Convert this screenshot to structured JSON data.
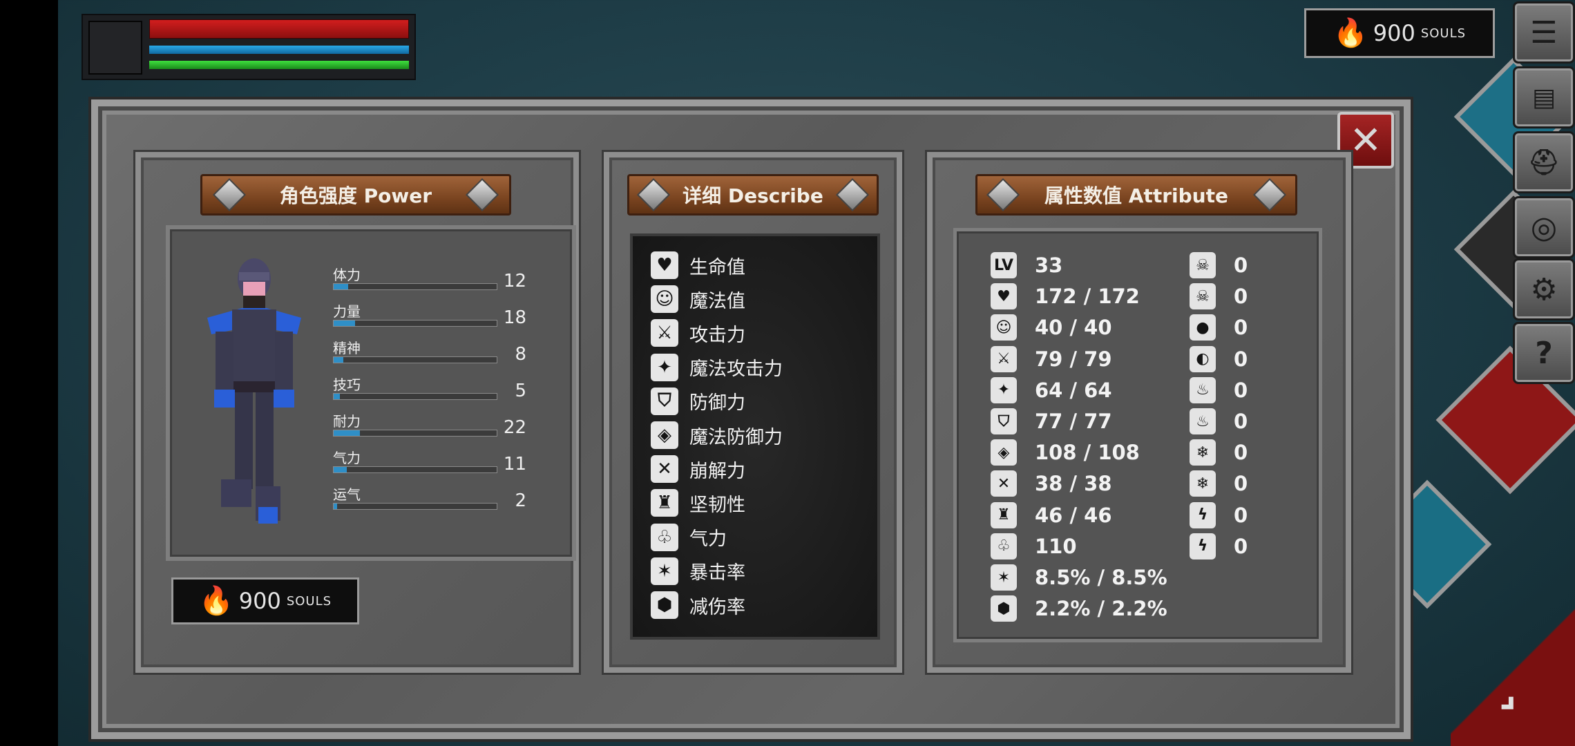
{
  "souls": {
    "amount": "900",
    "unit": "SOULS"
  },
  "menu": {
    "items": [
      {
        "icon": "list-icon",
        "glyph": "☰"
      },
      {
        "icon": "scroll-icon",
        "glyph": "📜"
      },
      {
        "icon": "helmet-icon",
        "glyph": "⛑"
      },
      {
        "icon": "emblem-icon",
        "glyph": "◎"
      },
      {
        "icon": "gear-icon",
        "glyph": "⚙"
      },
      {
        "icon": "help-icon",
        "glyph": "?"
      }
    ]
  },
  "power": {
    "title": "角色强度 Power",
    "stats": [
      {
        "label": "体力",
        "value": "12",
        "fill": 0.09
      },
      {
        "label": "力量",
        "value": "18",
        "fill": 0.13
      },
      {
        "label": "精神",
        "value": "8",
        "fill": 0.06
      },
      {
        "label": "技巧",
        "value": "5",
        "fill": 0.04
      },
      {
        "label": "耐力",
        "value": "22",
        "fill": 0.16
      },
      {
        "label": "气力",
        "value": "11",
        "fill": 0.08
      },
      {
        "label": "运气",
        "value": "2",
        "fill": 0.02
      }
    ]
  },
  "describe": {
    "title": "详细 Describe",
    "rows": [
      {
        "label": "生命值",
        "icon": "heart-icon",
        "glyph": "♥"
      },
      {
        "label": "魔法值",
        "icon": "head-icon",
        "glyph": "☺"
      },
      {
        "label": "攻击力",
        "icon": "sword-icon",
        "glyph": "⚔"
      },
      {
        "label": "魔法攻击力",
        "icon": "spellbook-icon",
        "glyph": "✦"
      },
      {
        "label": "防御力",
        "icon": "shield-icon",
        "glyph": "⛉"
      },
      {
        "label": "魔法防御力",
        "icon": "magic-shield-icon",
        "glyph": "◈"
      },
      {
        "label": "崩解力",
        "icon": "break-icon",
        "glyph": "✕"
      },
      {
        "label": "坚韧性",
        "icon": "knight-helmet-icon",
        "glyph": "♜"
      },
      {
        "label": "气力",
        "icon": "lungs-icon",
        "glyph": "♧"
      },
      {
        "label": "暴击率",
        "icon": "star-burst-icon",
        "glyph": "✶"
      },
      {
        "label": "减伤率",
        "icon": "shield-badge-icon",
        "glyph": "⬢"
      }
    ]
  },
  "attribute": {
    "title": "属性数值 Attribute",
    "left": [
      {
        "icon": "level-icon",
        "glyph": "LV",
        "value": "33"
      },
      {
        "icon": "heart-icon",
        "glyph": "♥",
        "value": "172 / 172"
      },
      {
        "icon": "head-icon",
        "glyph": "☺",
        "value": "40 / 40"
      },
      {
        "icon": "sword-icon",
        "glyph": "⚔",
        "value": "79 / 79"
      },
      {
        "icon": "spellbook-icon",
        "glyph": "✦",
        "value": "64 / 64"
      },
      {
        "icon": "shield-icon",
        "glyph": "⛉",
        "value": "77 / 77"
      },
      {
        "icon": "magic-shield-icon",
        "glyph": "◈",
        "value": "108 / 108"
      },
      {
        "icon": "break-icon",
        "glyph": "✕",
        "value": "38 / 38"
      },
      {
        "icon": "knight-helmet-icon",
        "glyph": "♜",
        "value": "46 / 46"
      },
      {
        "icon": "lungs-icon",
        "glyph": "♧",
        "value": "110"
      },
      {
        "icon": "star-burst-icon",
        "glyph": "✶",
        "value": "8.5% / 8.5%"
      },
      {
        "icon": "shield-badge-icon",
        "glyph": "⬢",
        "value": "2.2% / 2.2%"
      }
    ],
    "right": [
      {
        "icon": "skull-icon",
        "glyph": "☠",
        "value": "0"
      },
      {
        "icon": "skull-resist-icon",
        "glyph": "☠",
        "value": "0"
      },
      {
        "icon": "drop-icon",
        "glyph": "●",
        "value": "0"
      },
      {
        "icon": "drop-resist-icon",
        "glyph": "◐",
        "value": "0"
      },
      {
        "icon": "fire-icon",
        "glyph": "♨",
        "value": "0"
      },
      {
        "icon": "fire-resist-icon",
        "glyph": "♨",
        "value": "0"
      },
      {
        "icon": "frost-icon",
        "glyph": "❄",
        "value": "0"
      },
      {
        "icon": "frost-resist-icon",
        "glyph": "❄",
        "value": "0"
      },
      {
        "icon": "lightning-icon",
        "glyph": "ϟ",
        "value": "0"
      },
      {
        "icon": "lightning-resist-icon",
        "glyph": "ϟ",
        "value": "0"
      }
    ]
  },
  "colors": {
    "hp": "#d21e1e",
    "mp": "#29a9e8",
    "stamina": "#3ee03e",
    "stat_fill": "#2f8fc7",
    "close": "#a52424"
  }
}
